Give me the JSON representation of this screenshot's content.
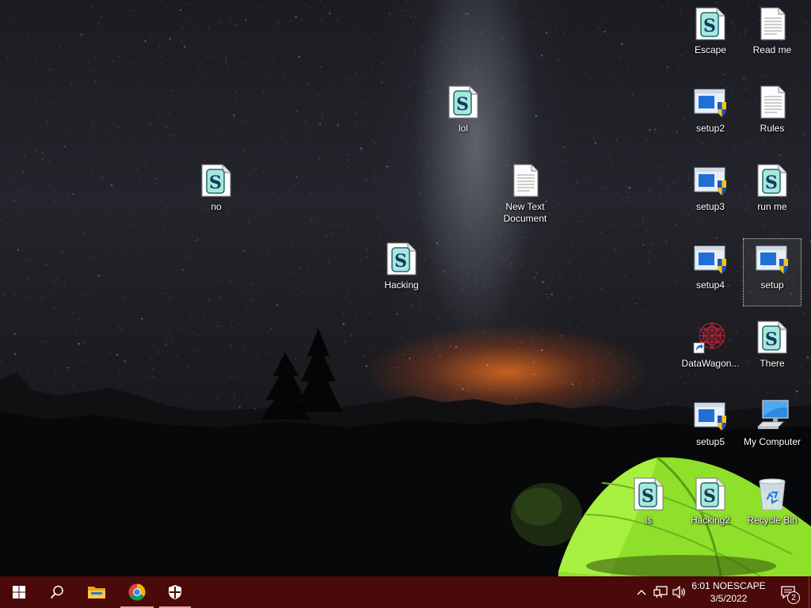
{
  "desktop": {
    "icons": [
      {
        "label": "Escape",
        "type": "script"
      },
      {
        "label": "Read me",
        "type": "text"
      },
      {
        "label": "lol",
        "type": "script"
      },
      {
        "label": "setup2",
        "type": "setup"
      },
      {
        "label": "Rules",
        "type": "text"
      },
      {
        "label": "no",
        "type": "script"
      },
      {
        "label": "New Text Document",
        "type": "text"
      },
      {
        "label": "setup3",
        "type": "setup"
      },
      {
        "label": "run me",
        "type": "script"
      },
      {
        "label": "Hacking",
        "type": "script"
      },
      {
        "label": "setup4",
        "type": "setup"
      },
      {
        "label": "setup",
        "type": "setup",
        "selected": true
      },
      {
        "label": "DataWagon...",
        "type": "shortcut"
      },
      {
        "label": "There",
        "type": "script"
      },
      {
        "label": "setup5",
        "type": "setup"
      },
      {
        "label": "My Computer",
        "type": "computer"
      },
      {
        "label": "is",
        "type": "script"
      },
      {
        "label": "Hacking2",
        "type": "script"
      },
      {
        "label": "Recycle Bin",
        "type": "recycle"
      }
    ]
  },
  "taskbar": {
    "start": {
      "icon": "windows-logo-icon"
    },
    "search": {
      "icon": "search-icon"
    },
    "apps": [
      {
        "name": "file-explorer",
        "icon": "folder-icon"
      },
      {
        "name": "chrome",
        "icon": "chrome-icon",
        "active": true
      },
      {
        "name": "security",
        "icon": "shield-icon",
        "active": true
      }
    ],
    "tray": {
      "clock_time": "6:01 NOESCAPE",
      "clock_date": "3/5/2022",
      "notification_count": "2"
    }
  },
  "colors": {
    "taskbar": "#4a0a0a",
    "tent": "#8ee02a",
    "horizon_glow": "#ff7a1e"
  }
}
